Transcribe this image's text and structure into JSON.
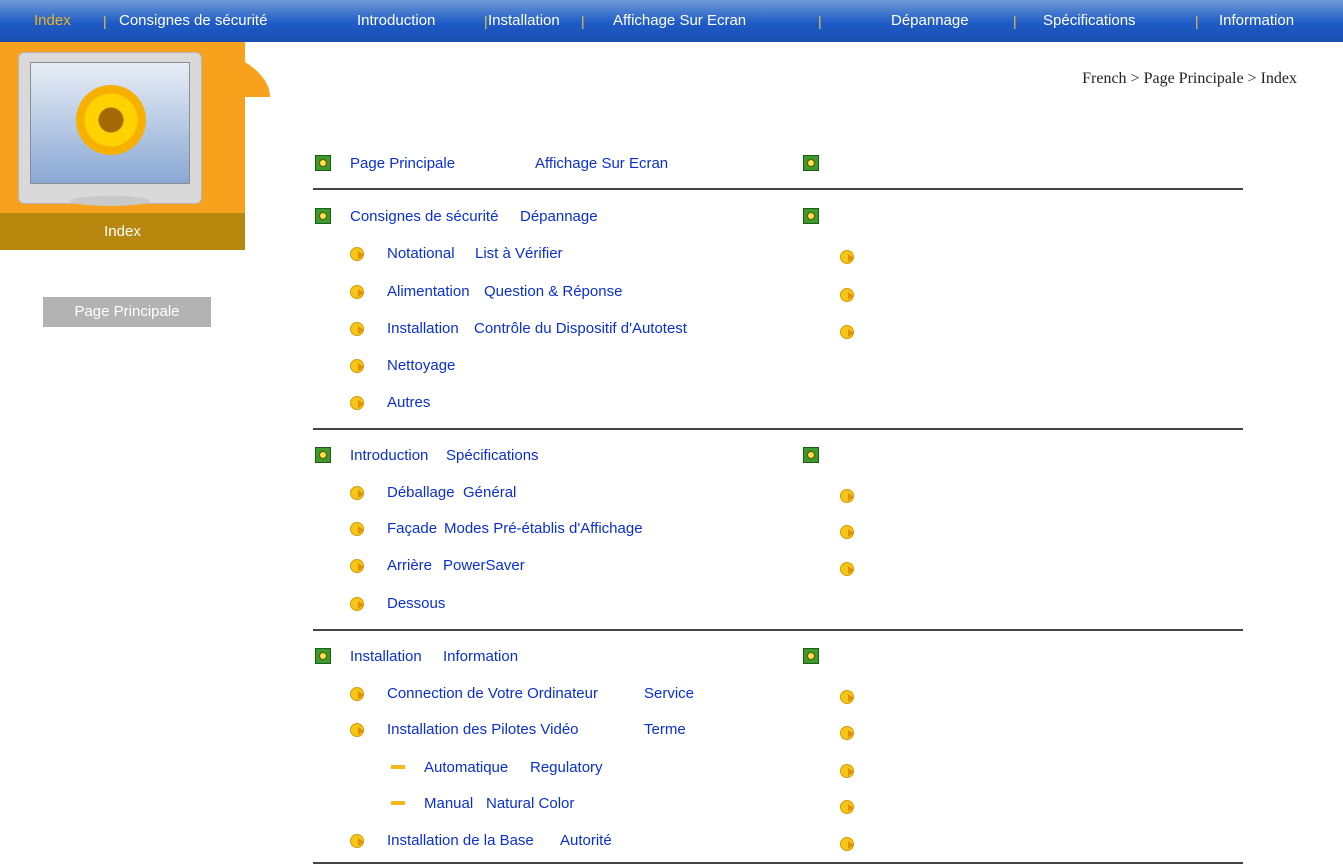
{
  "nav": {
    "items": [
      "Index",
      "Consignes de sécurité",
      "Introduction",
      "Installation",
      "Affichage Sur Ecran",
      "Dépannage",
      "Spécifications",
      "Information"
    ]
  },
  "sidebar": {
    "section_title": "Index",
    "home_button": "Page Principale"
  },
  "breadcrumb": "French > Page Principale > Index",
  "sections": [
    {
      "left": "Page Principale",
      "right": "Affichage Sur Ecran",
      "items": []
    },
    {
      "left": "Consignes de sécurité",
      "right": "Dépannage",
      "items": [
        {
          "left": "Notational",
          "right": "List à Vérifier"
        },
        {
          "left": "Alimentation",
          "right": "Question & Réponse"
        },
        {
          "left": "Installation",
          "right": "Contrôle du Dispositif d'Autotest"
        },
        {
          "left": "Nettoyage",
          "right": ""
        },
        {
          "left": "Autres",
          "right": ""
        }
      ]
    },
    {
      "left": "Introduction",
      "right": "Spécifications",
      "items": [
        {
          "left": "Déballage",
          "right": "Général"
        },
        {
          "left": "Façade",
          "right": "Modes Pré-établis d'Affichage"
        },
        {
          "left": "Arrière",
          "right": "PowerSaver"
        },
        {
          "left": "Dessous",
          "right": ""
        }
      ]
    },
    {
      "left": "Installation",
      "right": "Information",
      "items": [
        {
          "left": "Connection de Votre Ordinateur",
          "right": "Service"
        },
        {
          "left": "Installation des Pilotes Vidéo",
          "right": "Terme"
        },
        {
          "left": "Automatique",
          "right": "Regulatory",
          "sub": true
        },
        {
          "left": "Manual",
          "right": "Natural Color",
          "sub": true
        },
        {
          "left": "Installation de la Base",
          "right": "Autorité"
        }
      ]
    }
  ]
}
